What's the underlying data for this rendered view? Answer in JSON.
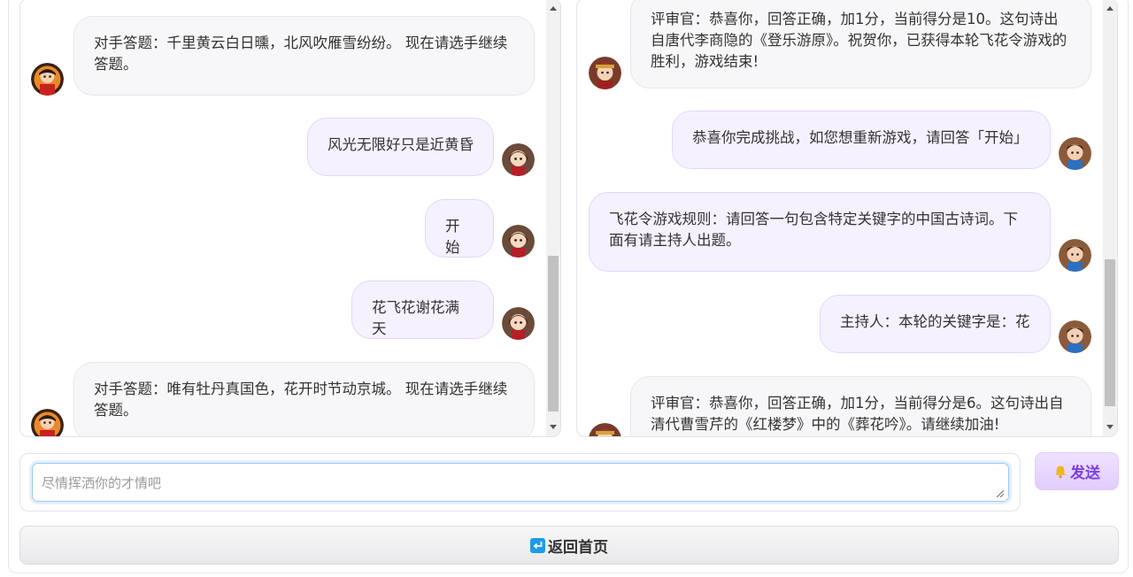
{
  "left_chat": {
    "messages": [
      {
        "role": "bot",
        "text": "对手答题：千里黄云白日曛，北风吹雁雪纷纷。 现在请选手继续答题。"
      },
      {
        "role": "user",
        "text": "风光无限好只是近黄昏"
      },
      {
        "role": "user",
        "text": "开始"
      },
      {
        "role": "user",
        "text": "花飞花谢花满天"
      },
      {
        "role": "bot",
        "text": "对手答题：唯有牡丹真国色，花开时节动京城。 现在请选手继续答题。"
      }
    ]
  },
  "right_chat": {
    "messages": [
      {
        "role": "judge",
        "text": "评审官：恭喜你，回答正确，加1分，当前得分是10。这句诗出自唐代李商隐的《登乐游原》。祝贺你，已获得本轮飞花令游戏的胜利，游戏结束!"
      },
      {
        "role": "host",
        "text": "恭喜你完成挑战，如您想重新游戏，请回答「开始」"
      },
      {
        "role": "host",
        "text": "飞花令游戏规则：请回答一句包含特定关键字的中国古诗词。下面有请主持人出题。"
      },
      {
        "role": "host",
        "text": "主持人：本轮的关键字是：花"
      },
      {
        "role": "judge",
        "text": "评审官：恭喜你，回答正确，加1分，当前得分是6。这句诗出自清代曹雪芹的《红楼梦》中的《葬花吟》。请继续加油!"
      }
    ]
  },
  "input": {
    "placeholder": "尽情挥洒你的才情吧",
    "value": ""
  },
  "send_button": {
    "label": "发送",
    "icon": "bell-icon"
  },
  "home_button": {
    "label": "返回首页",
    "icon": "return-icon"
  },
  "colors": {
    "user_bubble": "#f6f1ff",
    "bot_bubble": "#f7f7f9",
    "send_text": "#7a3fe0",
    "return_icon": "#1e9be8"
  }
}
